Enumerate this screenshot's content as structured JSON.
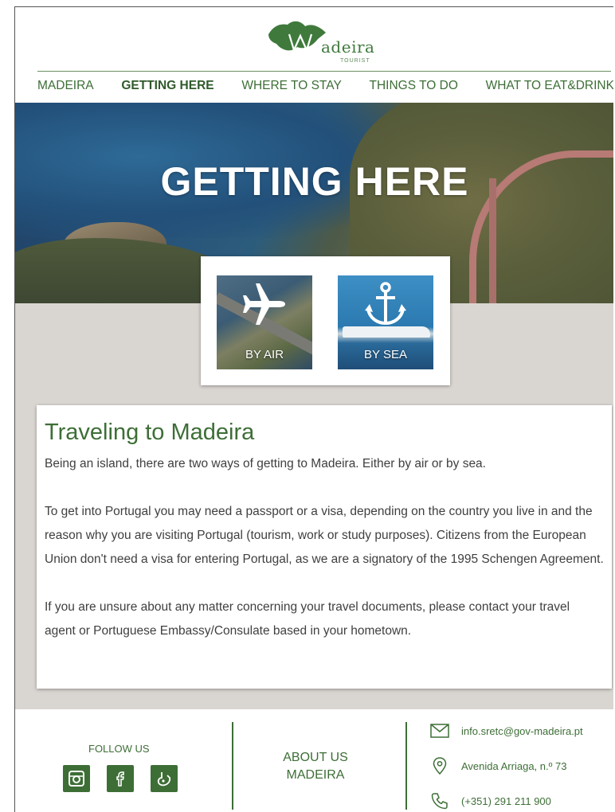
{
  "brand": {
    "name": "adeira",
    "initial": "M",
    "subtitle": "TOURIST"
  },
  "nav": {
    "items": [
      {
        "label": "MADEIRA"
      },
      {
        "label": "GETTING HERE"
      },
      {
        "label": "WHERE TO STAY"
      },
      {
        "label": "THINGS TO DO"
      },
      {
        "label": "WHAT TO EAT&DRINK"
      }
    ],
    "active_index": 1
  },
  "hero": {
    "title": "GETTING HERE"
  },
  "options": {
    "air": {
      "label": "BY AIR",
      "icon": "airplane-icon"
    },
    "sea": {
      "label": "BY SEA",
      "icon": "anchor-icon"
    }
  },
  "article": {
    "title": "Traveling to Madeira",
    "paragraphs": [
      "Being an island, there are two ways of getting to Madeira. Either by air or by sea.",
      "To get into Portugal you may need a passport or a visa, depending on the country you live in and the reason why you are visiting Portugal (tourism, work or study purposes). Citizens from the European Union don't need a visa for entering Portugal, as we are a signatory of the 1995 Schengen Agreement.",
      "If you are unsure about any matter concerning your travel documents, please contact your travel agent or Portuguese Embassy/Consulate based in your hometown."
    ]
  },
  "footer": {
    "follow_label": "FOLLOW US",
    "social": [
      {
        "icon": "instagram-icon"
      },
      {
        "icon": "facebook-icon"
      },
      {
        "icon": "tripadvisor-icon"
      }
    ],
    "about_line1": "ABOUT US",
    "about_line2": "MADEIRA",
    "email": "info.sretc@gov-madeira.pt",
    "address": "Avenida Arriaga, n.º 73",
    "phone": "(+351) 291 211 900"
  },
  "colors": {
    "brand_green": "#3d6e36",
    "band_gray": "#d9d5d1"
  }
}
